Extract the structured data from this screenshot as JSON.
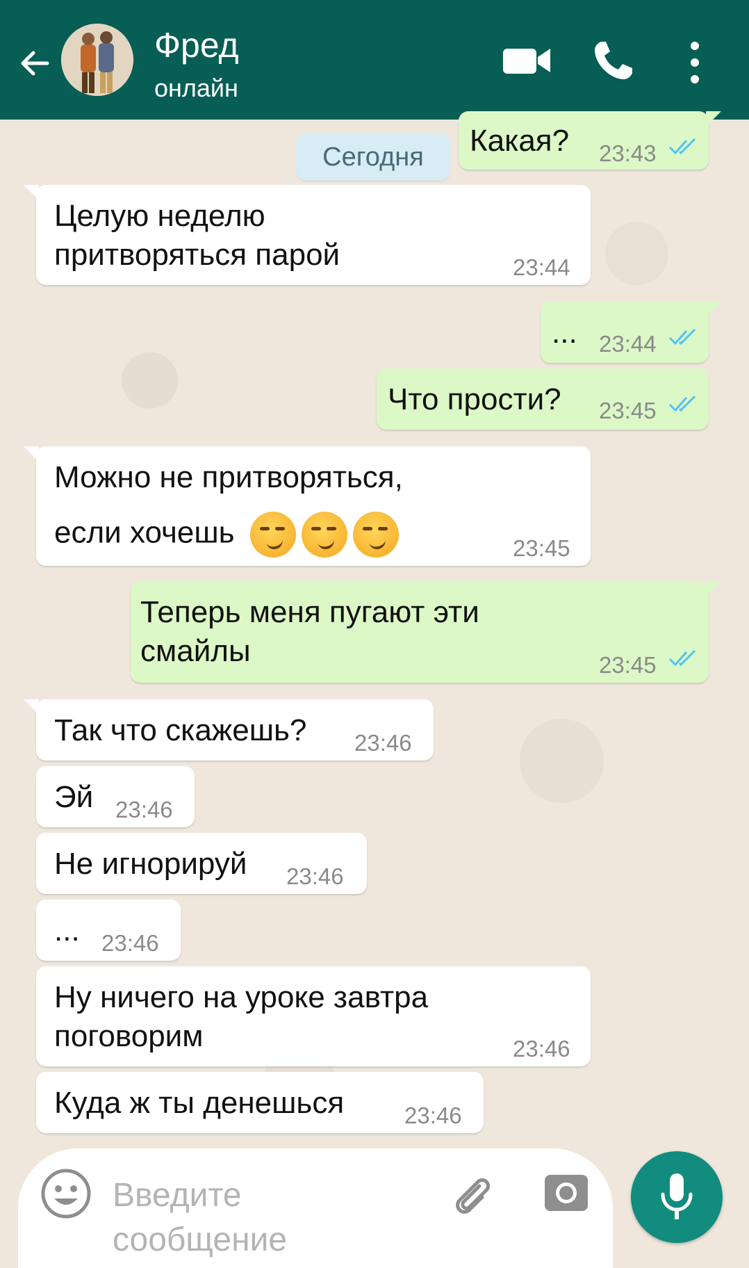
{
  "header": {
    "contact_name": "Фред",
    "status": "онлайн",
    "bg_color": "#075e54",
    "icons": [
      "back-arrow-icon",
      "avatar",
      "video-call-icon",
      "phone-icon",
      "more-vert-icon"
    ]
  },
  "date_chip": "Сегодня",
  "messages": [
    {
      "dir": "out",
      "lines": [
        "Какая?"
      ],
      "time": "23:43",
      "read": true
    },
    {
      "dir": "in",
      "lines": [
        "Целую неделю",
        "притворяться парой"
      ],
      "time": "23:44"
    },
    {
      "dir": "out",
      "lines": [
        "..."
      ],
      "time": "23:44",
      "read": true
    },
    {
      "dir": "out",
      "lines": [
        "Что прости?"
      ],
      "time": "23:45",
      "read": true
    },
    {
      "dir": "in",
      "lines": [
        "Можно не притворяться,",
        "если хочешь"
      ],
      "time": "23:45",
      "emoji": "smirking-face x3"
    },
    {
      "dir": "out",
      "lines": [
        "Теперь меня пугают эти",
        "смайлы"
      ],
      "time": "23:45",
      "read": true
    },
    {
      "dir": "in",
      "lines": [
        "Так что скажешь?"
      ],
      "time": "23:46"
    },
    {
      "dir": "in",
      "lines": [
        "Эй"
      ],
      "time": "23:46"
    },
    {
      "dir": "in",
      "lines": [
        "Не игнорируй"
      ],
      "time": "23:46"
    },
    {
      "dir": "in",
      "lines": [
        "..."
      ],
      "time": "23:46"
    },
    {
      "dir": "in",
      "lines": [
        "Ну ничего на уроке завтра",
        "поговорим"
      ],
      "time": "23:46"
    },
    {
      "dir": "in",
      "lines": [
        "Куда ж ты денешься"
      ],
      "time": "23:46"
    }
  ],
  "input": {
    "placeholder_line1": "Введите",
    "placeholder_line2": "сообщение"
  },
  "colors": {
    "outgoing_bubble": "#dcf8c6",
    "incoming_bubble": "#ffffff",
    "read_ticks": "#4fc3f7",
    "mic_button": "#128c7e"
  }
}
